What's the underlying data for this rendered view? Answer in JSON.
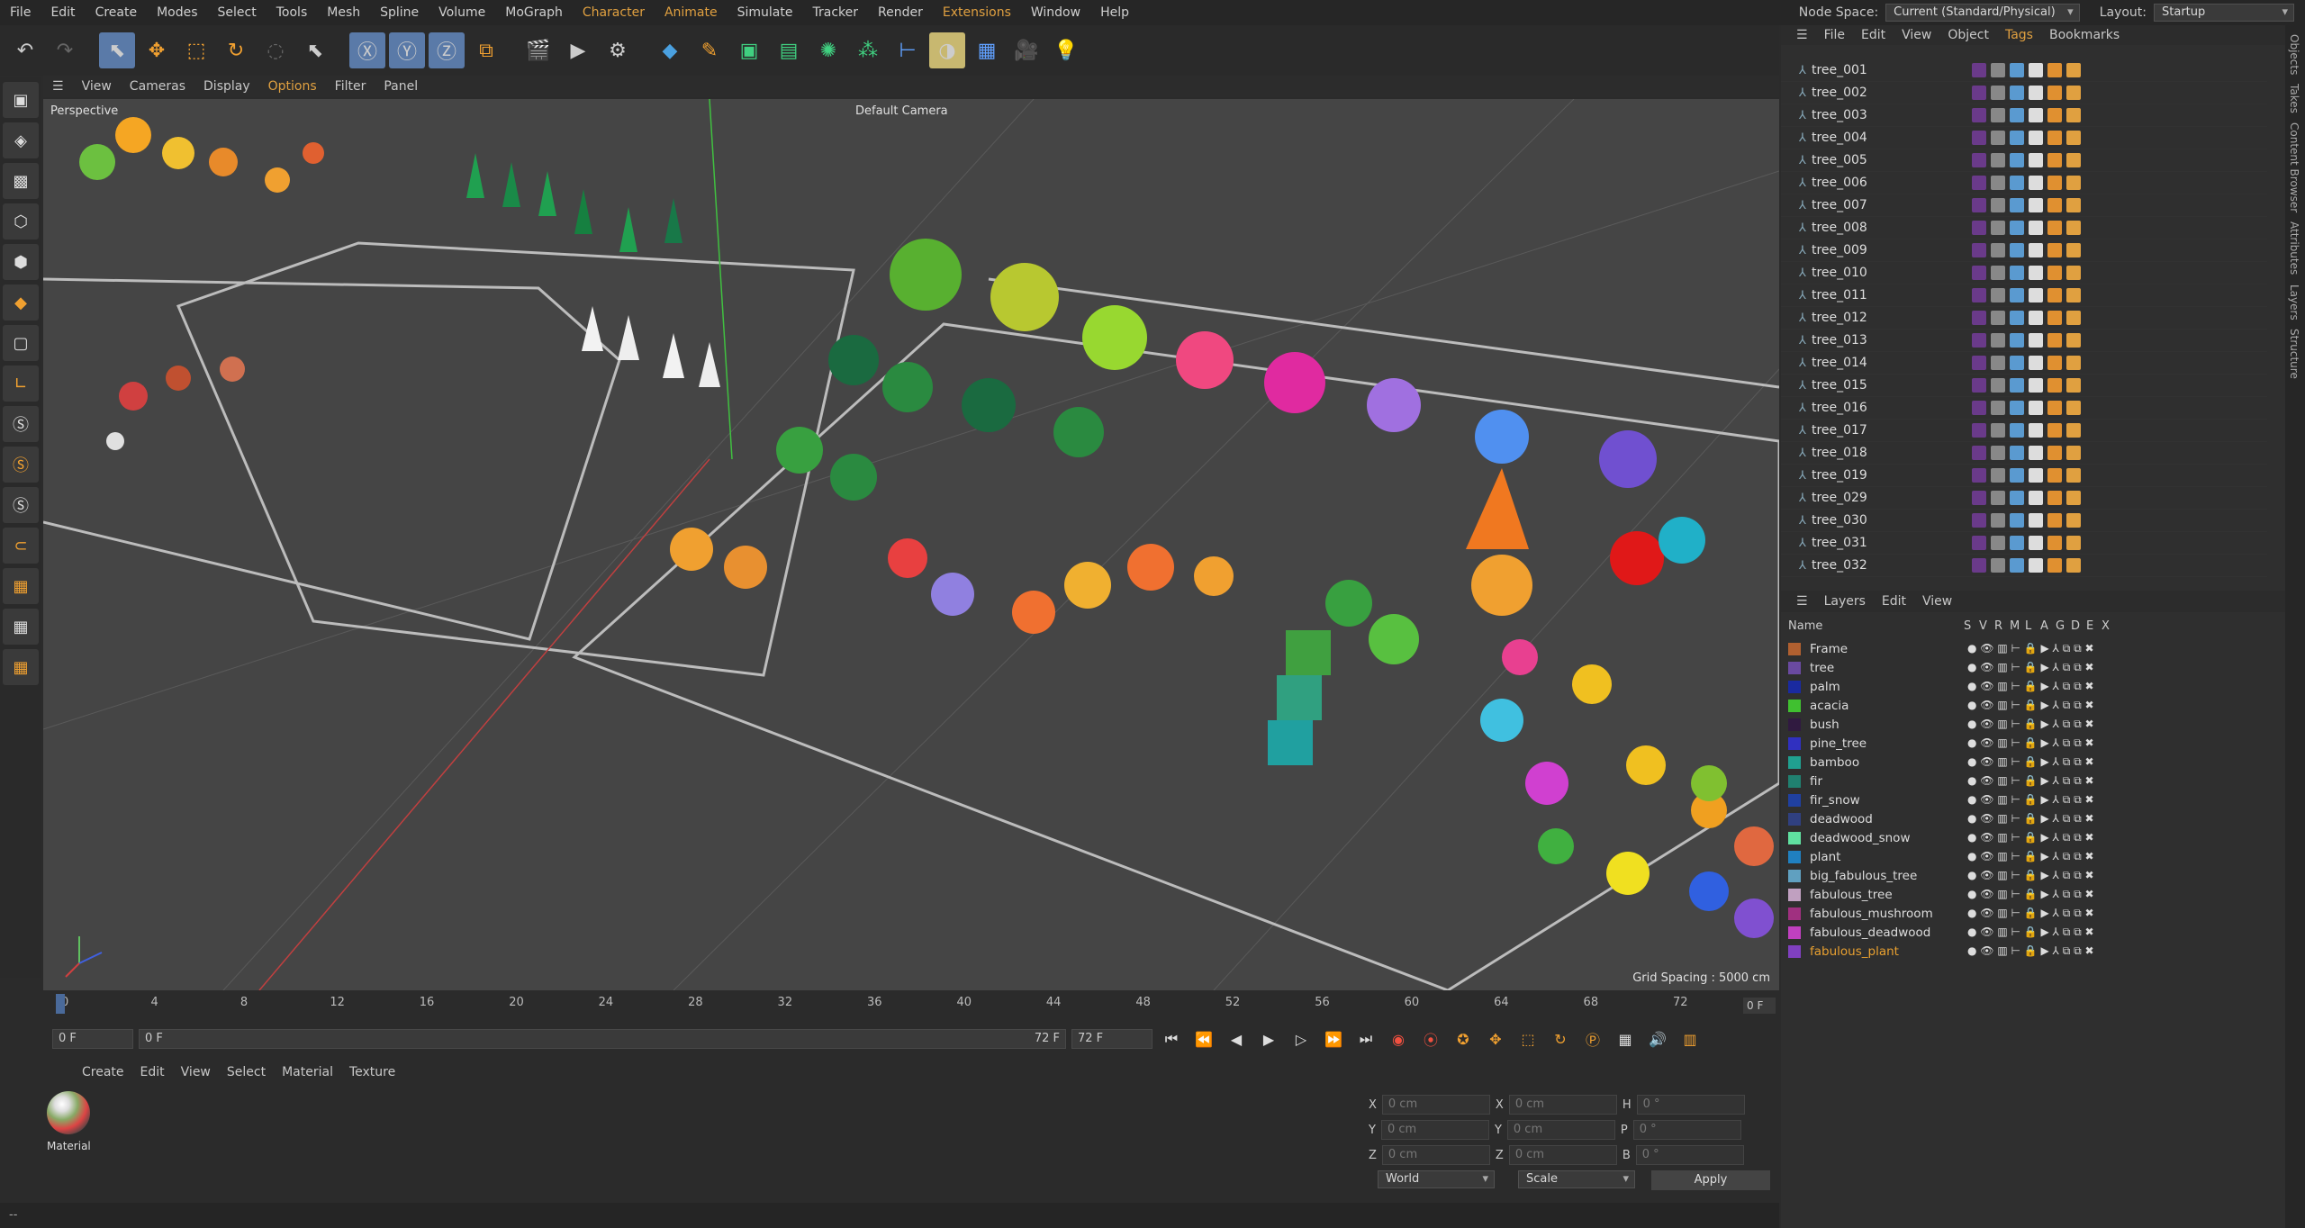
{
  "menu": [
    "File",
    "Edit",
    "Create",
    "Modes",
    "Select",
    "Tools",
    "Mesh",
    "Spline",
    "Volume",
    "MoGraph",
    "Character",
    "Animate",
    "Simulate",
    "Tracker",
    "Render",
    "Extensions",
    "Window",
    "Help"
  ],
  "menu_highlight": [
    "Character",
    "Animate",
    "Extensions"
  ],
  "node_space_label": "Node Space:",
  "node_space_value": "Current (Standard/Physical)",
  "layout_label": "Layout:",
  "layout_value": "Startup",
  "viewport_menu": [
    "View",
    "Cameras",
    "Display",
    "Options",
    "Filter",
    "Panel"
  ],
  "viewport_label": "Perspective",
  "camera_label": "Default Camera",
  "grid_spacing": "Grid Spacing : 5000 cm",
  "timeline_ticks": [
    "0",
    "4",
    "8",
    "12",
    "16",
    "20",
    "24",
    "28",
    "32",
    "36",
    "40",
    "44",
    "48",
    "52",
    "56",
    "60",
    "64",
    "68",
    "72"
  ],
  "timeline_current": "0 F",
  "transport": {
    "start": "0 F",
    "range_start": "0 F",
    "range_end": "72 F",
    "end": "72 F"
  },
  "material_menu": [
    "Create",
    "Edit",
    "View",
    "Select",
    "Material",
    "Texture"
  ],
  "material_name": "Material",
  "coords": {
    "x": "0 cm",
    "y": "0 cm",
    "z": "0 cm",
    "h": "0 °",
    "p": "0 °",
    "b": "0 °",
    "mode": "World",
    "scale": "Scale",
    "apply": "Apply"
  },
  "object_menu": [
    "File",
    "Edit",
    "View",
    "Object",
    "Tags",
    "Bookmarks"
  ],
  "objects": [
    "tree_001",
    "tree_002",
    "tree_003",
    "tree_004",
    "tree_005",
    "tree_006",
    "tree_007",
    "tree_008",
    "tree_009",
    "tree_010",
    "tree_011",
    "tree_012",
    "tree_013",
    "tree_014",
    "tree_015",
    "tree_016",
    "tree_017",
    "tree_018",
    "tree_019",
    "tree_029",
    "tree_030",
    "tree_031",
    "tree_032"
  ],
  "layers_menu": [
    "Layers",
    "Edit",
    "View"
  ],
  "layer_header": {
    "name": "Name",
    "cols": [
      "S",
      "V",
      "R",
      "M",
      "L",
      "A",
      "G",
      "D",
      "E",
      "X"
    ]
  },
  "layers": [
    {
      "name": "Frame",
      "color": "#b06030"
    },
    {
      "name": "tree",
      "color": "#6a4aa0"
    },
    {
      "name": "palm",
      "color": "#1a2aa0"
    },
    {
      "name": "acacia",
      "color": "#40c030"
    },
    {
      "name": "bush",
      "color": "#301a40"
    },
    {
      "name": "pine_tree",
      "color": "#3030c0"
    },
    {
      "name": "bamboo",
      "color": "#20a090"
    },
    {
      "name": "fir",
      "color": "#208070"
    },
    {
      "name": "fir_snow",
      "color": "#2040a0"
    },
    {
      "name": "deadwood",
      "color": "#304080"
    },
    {
      "name": "deadwood_snow",
      "color": "#60e0a0"
    },
    {
      "name": "plant",
      "color": "#2080c0"
    },
    {
      "name": "big_fabulous_tree",
      "color": "#60a0c0"
    },
    {
      "name": "fabulous_tree",
      "color": "#c0a0c0"
    },
    {
      "name": "fabulous_mushroom",
      "color": "#a03080"
    },
    {
      "name": "fabulous_deadwood",
      "color": "#c040c0"
    },
    {
      "name": "fabulous_plant",
      "color": "#8040c0"
    }
  ],
  "status": "--",
  "right_tabs": [
    "Objects",
    "Takes",
    "Content Browser",
    "Attributes",
    "Layers",
    "Structure"
  ]
}
